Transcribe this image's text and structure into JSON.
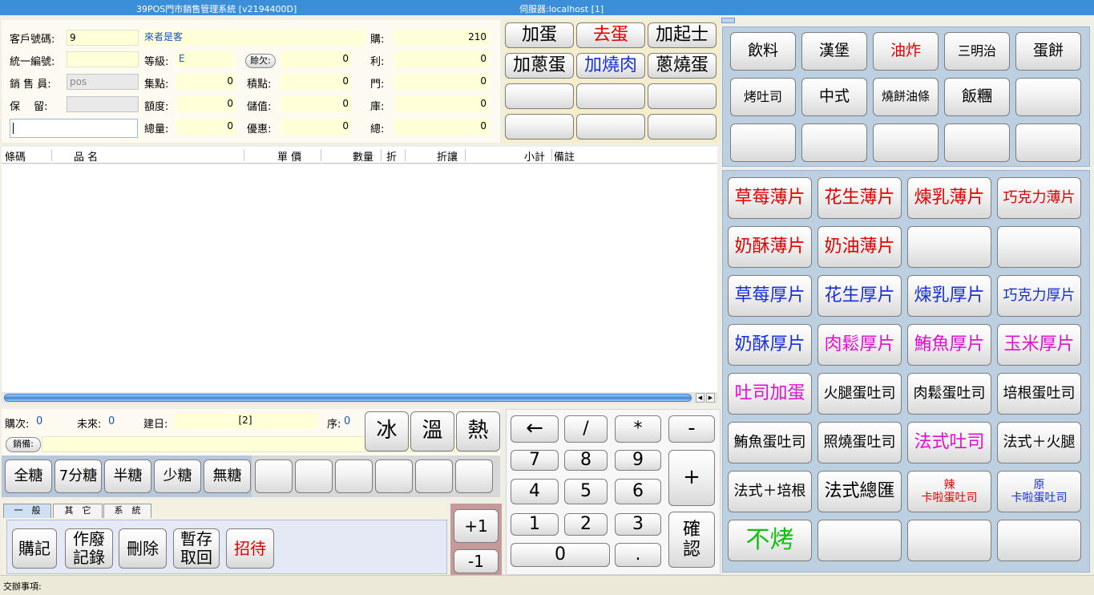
{
  "titlebar": {
    "title": "39POS門市銷售管理系統 [v2194400D]",
    "server": "伺服器:localhost [1]"
  },
  "customer": {
    "code_label": "客戶號碼:",
    "code_value": "9",
    "name_value": "來者是客",
    "taxid_label": "統一編號:",
    "taxid_value": "",
    "level_label": "等級:",
    "level_value": "E",
    "credit_button": "賒欠:",
    "credit_value": "0",
    "sales_label": "銷 售 員:",
    "sales_value": "pos",
    "points_label": "集點:",
    "points_value": "0",
    "accum_label": "積點:",
    "accum_value": "0",
    "hold_label": "保　 留:",
    "hold_value": "",
    "quota_label": "額度:",
    "quota_value": "0",
    "stored_label": "儲值:",
    "stored_value": "0",
    "total_qty_label": "總量:",
    "total_qty_value": "0",
    "discount_label": "優惠:",
    "discount_value": "0",
    "barcode_input": "",
    "buy_label": "購:",
    "buy_value": "210",
    "profit_label": "利:",
    "profit_value": "0",
    "store_label": "門:",
    "store_value": "0",
    "stock_label": "庫:",
    "stock_value": "0",
    "total_label": "總:",
    "total_value": "0"
  },
  "modifiers": [
    "加蛋",
    "去蛋",
    "加起士",
    "加蔥蛋",
    "加燒肉",
    "蔥燒蛋",
    "",
    "",
    "",
    "",
    "",
    ""
  ],
  "grid": {
    "columns": [
      "條碼",
      "品 名",
      "單 價",
      "數量",
      "折",
      "折讓",
      "小計",
      "備註"
    ]
  },
  "orderinfo": {
    "times_label": "購次:",
    "times_value": "0",
    "future_label": "未來:",
    "future_value": "0",
    "date_label": "建日:",
    "date_value": "[2]",
    "seq_label": "序:",
    "seq_value": "0",
    "note_button": "銷備:",
    "note_value": ""
  },
  "temperature": [
    "冰",
    "溫",
    "熱"
  ],
  "sugar": [
    "全糖",
    "7分糖",
    "半糖",
    "少糖",
    "無糖"
  ],
  "tabs": [
    "一　般",
    "其　它",
    "系　統"
  ],
  "actions": [
    "購記",
    "作廢\n記錄",
    "刪除",
    "暫存\n取回",
    "招待"
  ],
  "plusminus": [
    "+1",
    "-1"
  ],
  "numpad": {
    "back": "←",
    "div": "/",
    "mul": "*",
    "minus": "-",
    "plus": "+",
    "d7": "7",
    "d8": "8",
    "d9": "9",
    "d4": "4",
    "d5": "5",
    "d6": "6",
    "d1": "1",
    "d2": "2",
    "d3": "3",
    "d0": "0",
    "dot": ".",
    "confirm": "確\n認"
  },
  "categories": [
    "飲料",
    "漢堡",
    "油炸",
    "三明治",
    "蛋餅",
    "烤吐司",
    "中式",
    "燒餅油條",
    "飯糰",
    "",
    "",
    "",
    "",
    "",
    ""
  ],
  "products": [
    "草莓薄片",
    "花生薄片",
    "煉乳薄片",
    "巧克力薄片",
    "奶酥薄片",
    "奶油薄片",
    "",
    "",
    "草莓厚片",
    "花生厚片",
    "煉乳厚片",
    "巧克力厚片",
    "奶酥厚片",
    "肉鬆厚片",
    "鮪魚厚片",
    "玉米厚片",
    "吐司加蛋",
    "火腿蛋吐司",
    "肉鬆蛋吐司",
    "培根蛋吐司",
    "鮪魚蛋吐司",
    "照燒蛋吐司",
    "法式吐司",
    "法式＋火腿",
    "法式＋培根",
    "法式總匯",
    "辣\n卡啦蛋吐司",
    "原\n卡啦蛋吐司",
    "不烤",
    "",
    "",
    ""
  ],
  "colors": {
    "red": "#e00000",
    "blue": "#1630d6",
    "magenta": "#e010d0",
    "green": "#10c010",
    "titlebar": "#3a8fd8"
  },
  "statusbar": {
    "label": "交辦事項:"
  }
}
